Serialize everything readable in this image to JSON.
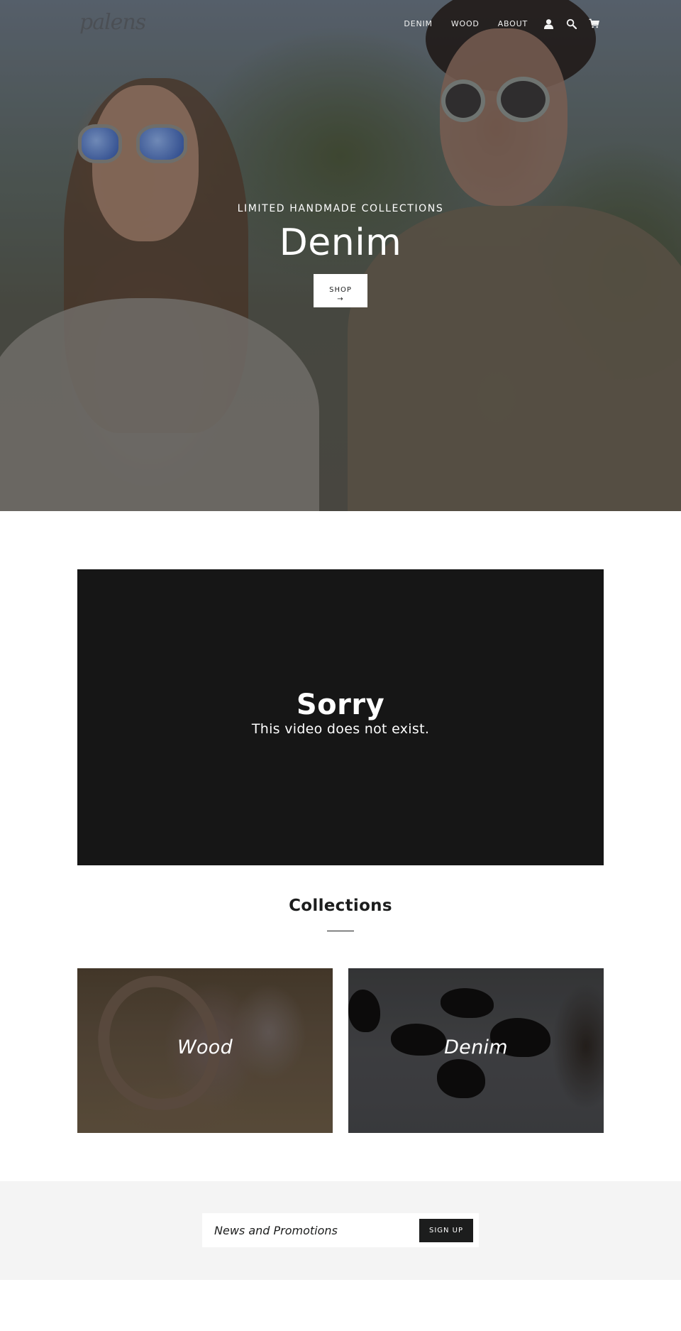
{
  "header": {
    "logo_text": "palens",
    "nav": [
      {
        "label": "DENIM"
      },
      {
        "label": "WOOD"
      },
      {
        "label": "ABOUT"
      }
    ],
    "icons": [
      "account-icon",
      "search-icon",
      "cart-icon"
    ]
  },
  "hero": {
    "subtitle": "LIMITED HANDMADE COLLECTIONS",
    "title": "Denim",
    "button_label": "SHOP",
    "button_arrow": "→"
  },
  "video": {
    "title": "Sorry",
    "message": "This video does not exist."
  },
  "collections": {
    "title": "Collections",
    "items": [
      {
        "label": "Wood"
      },
      {
        "label": "Denim"
      }
    ]
  },
  "newsletter": {
    "placeholder": "News and Promotions",
    "button_label": "SIGN UP"
  }
}
